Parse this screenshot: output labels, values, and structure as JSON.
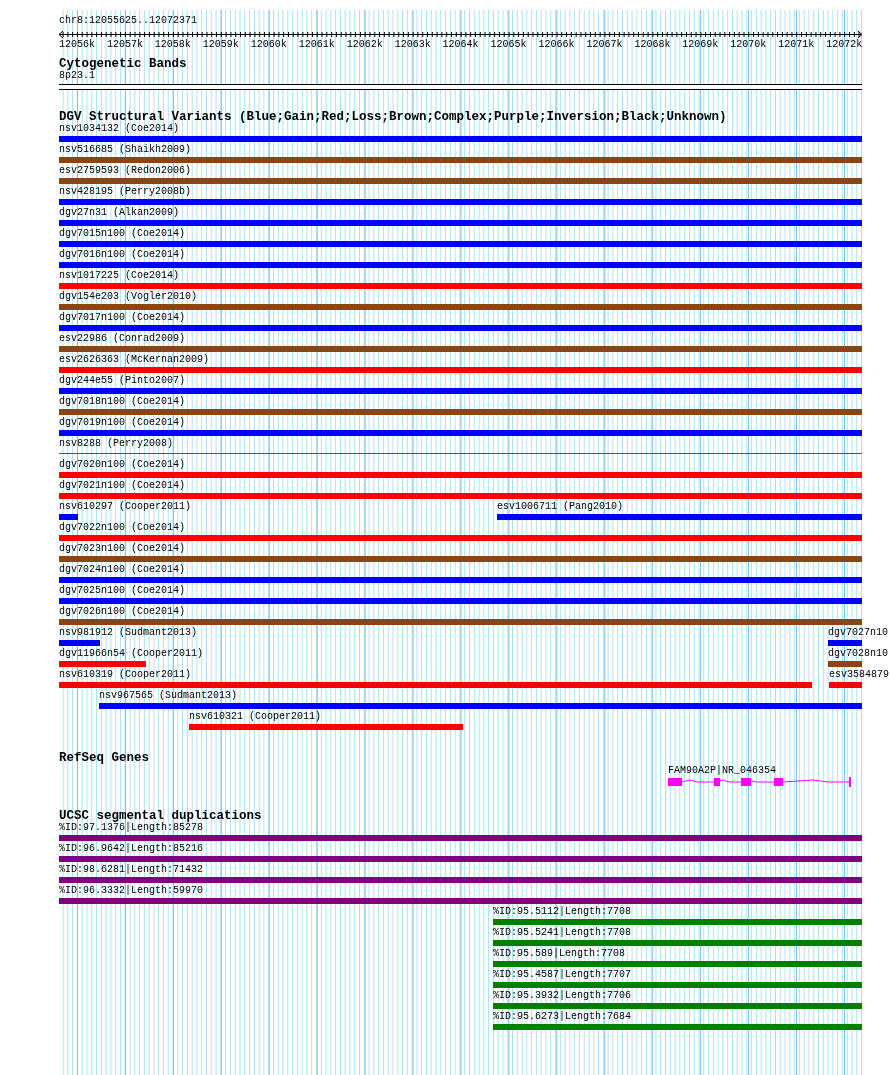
{
  "ruler": {
    "position": "chr8:12055625..12072371",
    "ticks": [
      {
        "label": "12056k"
      },
      {
        "label": "12057k"
      },
      {
        "label": "12058k"
      },
      {
        "label": "12059k"
      },
      {
        "label": "12060k"
      },
      {
        "label": "12061k"
      },
      {
        "label": "12062k"
      },
      {
        "label": "12063k"
      },
      {
        "label": "12064k"
      },
      {
        "label": "12065k"
      },
      {
        "label": "12066k"
      },
      {
        "label": "12067k"
      },
      {
        "label": "12068k"
      },
      {
        "label": "12069k"
      },
      {
        "label": "12070k"
      },
      {
        "label": "12071k"
      },
      {
        "label": "12072k"
      }
    ]
  },
  "cytoband": {
    "title": "Cytogenetic Bands",
    "band": "8p23.1"
  },
  "dgv": {
    "title": "DGV Structural Variants (Blue;Gain;Red;Loss;Brown;Complex;Purple;Inversion;Black;Unknown)",
    "rows": [
      {
        "items": [
          {
            "label": "nsv1034132 (Coe2014)",
            "kind": "bar",
            "color": "#0000ff"
          }
        ]
      },
      {
        "items": [
          {
            "label": "nsv516685 (Shaikh2009)",
            "kind": "bar",
            "color": "#8b4513"
          }
        ]
      },
      {
        "items": [
          {
            "label": "esv2759593 (Redon2006)",
            "kind": "bar",
            "color": "#8b4513"
          }
        ]
      },
      {
        "items": [
          {
            "label": "nsv428195 (Perry2008b)",
            "kind": "bar",
            "color": "#0000ff"
          }
        ]
      },
      {
        "items": [
          {
            "label": "dgv27n31 (Alkan2009)",
            "kind": "bar",
            "color": "#0000ff"
          }
        ]
      },
      {
        "items": [
          {
            "label": "dgv7015n100 (Coe2014)",
            "kind": "bar",
            "color": "#0000ff"
          }
        ]
      },
      {
        "items": [
          {
            "label": "dgv7016n100 (Coe2014)",
            "kind": "bar",
            "color": "#0000ff"
          }
        ]
      },
      {
        "items": [
          {
            "label": "nsv1017225 (Coe2014)",
            "kind": "bar",
            "color": "#ff0000"
          }
        ]
      },
      {
        "items": [
          {
            "label": "dgv154e203 (Vogler2010)",
            "kind": "bar",
            "color": "#8b4513"
          }
        ]
      },
      {
        "items": [
          {
            "label": "dgv7017n100 (Coe2014)",
            "kind": "bar",
            "color": "#0000ff"
          }
        ]
      },
      {
        "items": [
          {
            "label": "esv22986 (Conrad2009)",
            "kind": "bar",
            "color": "#8b4513"
          }
        ]
      },
      {
        "items": [
          {
            "label": "esv2626363 (McKernan2009)",
            "kind": "bar",
            "color": "#ff0000"
          }
        ]
      },
      {
        "items": [
          {
            "label": "dgv244e55 (Pinto2007)",
            "kind": "bar",
            "color": "#0000ff"
          }
        ]
      },
      {
        "items": [
          {
            "label": "dgv7018n100 (Coe2014)",
            "kind": "bar",
            "color": "#8b4513"
          }
        ]
      },
      {
        "items": [
          {
            "label": "dgv7019n100 (Coe2014)",
            "kind": "bar",
            "color": "#0000ff"
          }
        ]
      },
      {
        "items": [
          {
            "label": "nsv8288 (Perry2008)",
            "kind": "line",
            "color": "#8b4513"
          }
        ]
      },
      {
        "items": [
          {
            "label": "dgv7020n100 (Coe2014)",
            "kind": "bar",
            "color": "#ff0000"
          }
        ]
      },
      {
        "items": [
          {
            "label": "dgv7021n100 (Coe2014)",
            "kind": "bar",
            "color": "#ff0000"
          }
        ]
      },
      {
        "items": [
          {
            "label": "nsv610297 (Cooper2011)",
            "kind": "bar",
            "color": "#0000ff"
          },
          {
            "label": "esv1006711 (Pang2010)",
            "kind": "bar",
            "color": "#0000ff"
          }
        ]
      },
      {
        "items": [
          {
            "label": "dgv7022n100 (Coe2014)",
            "kind": "bar",
            "color": "#ff0000"
          }
        ]
      },
      {
        "items": [
          {
            "label": "dgv7023n100 (Coe2014)",
            "kind": "bar",
            "color": "#8b4513"
          }
        ]
      },
      {
        "items": [
          {
            "label": "dgv7024n100 (Coe2014)",
            "kind": "bar",
            "color": "#0000ff"
          }
        ]
      },
      {
        "items": [
          {
            "label": "dgv7025n100 (Coe2014)",
            "kind": "bar",
            "color": "#0000ff"
          }
        ]
      },
      {
        "items": [
          {
            "label": "dgv7026n100 (Coe2014)",
            "kind": "bar",
            "color": "#8b4513"
          }
        ]
      },
      {
        "items": [
          {
            "label": "nsv981912 (Sudmant2013)",
            "kind": "bar",
            "color": "#0000ff"
          },
          {
            "label": "dgv7027n10",
            "kind": "bar",
            "color": "#0000ff"
          }
        ]
      },
      {
        "items": [
          {
            "label": "dgv11966n54 (Cooper2011)",
            "kind": "bar",
            "color": "#ff0000"
          },
          {
            "label": "dgv7028n10",
            "kind": "bar",
            "color": "#8b4513"
          }
        ]
      },
      {
        "items": [
          {
            "label": "nsv610319 (Cooper2011)",
            "kind": "bar",
            "color": "#ff0000"
          },
          {
            "label": "esv3584879",
            "kind": "bar",
            "color": "#ff0000"
          }
        ]
      },
      {
        "items": [
          {
            "label": "nsv967565 (Sudmant2013)",
            "kind": "bar",
            "color": "#0000ff"
          }
        ]
      },
      {
        "items": [
          {
            "label": "nsv610321 (Cooper2011)",
            "kind": "bar",
            "color": "#ff0000"
          }
        ]
      }
    ]
  },
  "refseq": {
    "title": "RefSeq Genes",
    "genes": [
      {
        "label": "FAM90A2P|NR_046354"
      }
    ]
  },
  "segdups": {
    "title": "UCSC segmental duplications",
    "rows": [
      {
        "label": "%ID:97.1376|Length:85278",
        "color": "#800080"
      },
      {
        "label": "%ID:96.9642|Length:85216",
        "color": "#800080"
      },
      {
        "label": "%ID:98.6281|Length:71432",
        "color": "#800080"
      },
      {
        "label": "%ID:96.3332|Length:59970",
        "color": "#800080"
      },
      {
        "label": "%ID:95.5112|Length:7708",
        "color": "#008000"
      },
      {
        "label": "%ID:95.5241|Length:7708",
        "color": "#008000"
      },
      {
        "label": "%ID:95.589|Length:7708",
        "color": "#008000"
      },
      {
        "label": "%ID:95.4587|Length:7707",
        "color": "#008000"
      },
      {
        "label": "%ID:95.3932|Length:7706",
        "color": "#008000"
      },
      {
        "label": "%ID:95.6273|Length:7684",
        "color": "#008000"
      }
    ]
  }
}
